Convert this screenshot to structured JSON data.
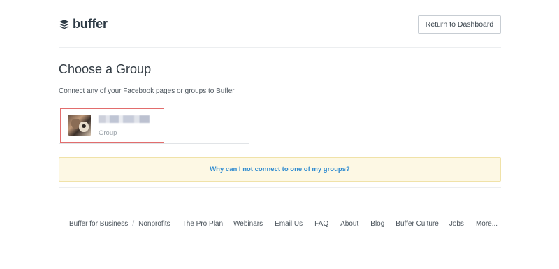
{
  "header": {
    "logo_text": "buffer",
    "logo_icon": "stack-icon",
    "return_button": "Return to Dashboard"
  },
  "main": {
    "title": "Choose a Group",
    "subtitle": "Connect any of your Facebook pages or groups to Buffer.",
    "groups": [
      {
        "type": "Group",
        "name_redacted": true
      }
    ],
    "help_link": "Why can I not connect to one of my groups?"
  },
  "footer": {
    "links": [
      "Buffer for Business",
      "Nonprofits",
      "The Pro Plan",
      "Webinars",
      "Email Us",
      "FAQ",
      "About",
      "Blog",
      "Buffer Culture",
      "Jobs",
      "More..."
    ],
    "separator": "/"
  },
  "colors": {
    "link": "#2f8bd0",
    "banner_bg": "#fdf8e4",
    "highlight_border": "#e26d6d"
  }
}
